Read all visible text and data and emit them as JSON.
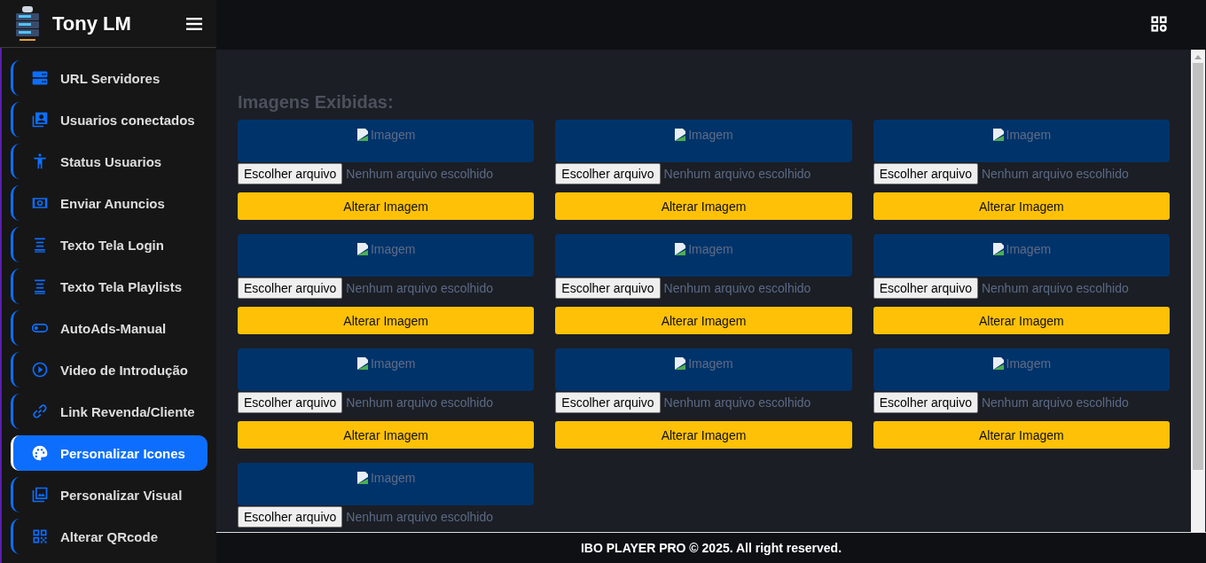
{
  "brand": {
    "title": "Tony LM"
  },
  "sidebar": {
    "items": [
      {
        "label": "URL Servidores",
        "selected": false
      },
      {
        "label": "Usuarios conectados",
        "selected": false
      },
      {
        "label": "Status Usuarios",
        "selected": false
      },
      {
        "label": "Enviar Anuncios",
        "selected": false
      },
      {
        "label": "Texto Tela Login",
        "selected": false
      },
      {
        "label": "Texto Tela Playlists",
        "selected": false
      },
      {
        "label": "AutoAds-Manual",
        "selected": false
      },
      {
        "label": "Video de Introdução",
        "selected": false
      },
      {
        "label": "Link Revenda/Cliente",
        "selected": false
      },
      {
        "label": "Personalizar Icones",
        "selected": true
      },
      {
        "label": "Personalizar Visual",
        "selected": false
      },
      {
        "label": "Alterar QRcode",
        "selected": false
      }
    ]
  },
  "content": {
    "heading": "Imagens Exibidas:",
    "tiles": [
      {
        "image_alt": "Imagem",
        "file_button": "Escolher arquivo",
        "file_status": "Nenhum arquivo escolhido",
        "button": "Alterar Imagem"
      },
      {
        "image_alt": "Imagem",
        "file_button": "Escolher arquivo",
        "file_status": "Nenhum arquivo escolhido",
        "button": "Alterar Imagem"
      },
      {
        "image_alt": "Imagem",
        "file_button": "Escolher arquivo",
        "file_status": "Nenhum arquivo escolhido",
        "button": "Alterar Imagem"
      },
      {
        "image_alt": "Imagem",
        "file_button": "Escolher arquivo",
        "file_status": "Nenhum arquivo escolhido",
        "button": "Alterar Imagem"
      },
      {
        "image_alt": "Imagem",
        "file_button": "Escolher arquivo",
        "file_status": "Nenhum arquivo escolhido",
        "button": "Alterar Imagem"
      },
      {
        "image_alt": "Imagem",
        "file_button": "Escolher arquivo",
        "file_status": "Nenhum arquivo escolhido",
        "button": "Alterar Imagem"
      },
      {
        "image_alt": "Imagem",
        "file_button": "Escolher arquivo",
        "file_status": "Nenhum arquivo escolhido",
        "button": "Alterar Imagem"
      },
      {
        "image_alt": "Imagem",
        "file_button": "Escolher arquivo",
        "file_status": "Nenhum arquivo escolhido",
        "button": "Alterar Imagem"
      },
      {
        "image_alt": "Imagem",
        "file_button": "Escolher arquivo",
        "file_status": "Nenhum arquivo escolhido",
        "button": "Alterar Imagem"
      },
      {
        "image_alt": "Imagem",
        "file_button": "Escolher arquivo",
        "file_status": "Nenhum arquivo escolhido"
      }
    ]
  },
  "footer": {
    "text": "IBO PLAYER PRO © 2025. All right reserved."
  }
}
